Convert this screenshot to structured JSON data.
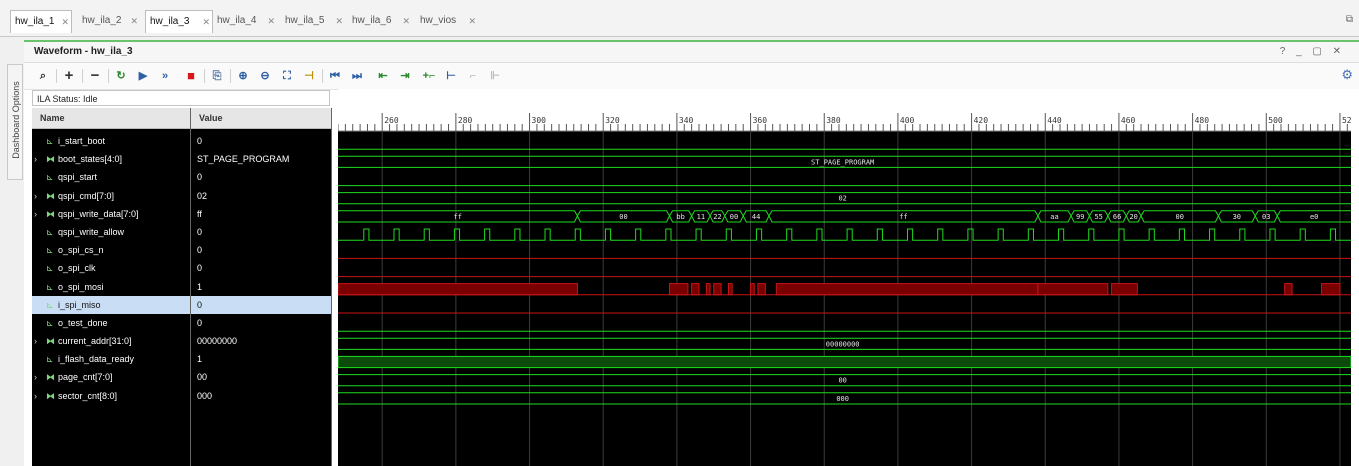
{
  "tabs": [
    {
      "label": "hw_ila_1",
      "active": true
    },
    {
      "label": "hw_ila_2",
      "active": false
    },
    {
      "label": "hw_ila_3",
      "active": true
    },
    {
      "label": "hw_ila_4",
      "active": false
    },
    {
      "label": "hw_ila_5",
      "active": false
    },
    {
      "label": "hw_ila_6",
      "active": false
    },
    {
      "label": "hw_vios",
      "active": false
    }
  ],
  "sidebar": {
    "dashboard_label": "Dashboard Options"
  },
  "panel": {
    "title": "Waveform - hw_ila_3",
    "controls": "? _ ▢ ✕"
  },
  "status": {
    "text": "ILA Status: Idle"
  },
  "columns": {
    "name": "Name",
    "value": "Value"
  },
  "signals": [
    {
      "name": "i_start_boot",
      "value": "0",
      "bus": false
    },
    {
      "name": "boot_states[4:0]",
      "value": "ST_PAGE_PROGRAM",
      "bus": true
    },
    {
      "name": "qspi_start",
      "value": "0",
      "bus": false
    },
    {
      "name": "qspi_cmd[7:0]",
      "value": "02",
      "bus": true
    },
    {
      "name": "qspi_write_data[7:0]",
      "value": "ff",
      "bus": true
    },
    {
      "name": "qspi_write_allow",
      "value": "0",
      "bus": false
    },
    {
      "name": "o_spi_cs_n",
      "value": "0",
      "bus": false
    },
    {
      "name": "o_spi_clk",
      "value": "0",
      "bus": false
    },
    {
      "name": "o_spi_mosi",
      "value": "1",
      "bus": false
    },
    {
      "name": "i_spi_miso",
      "value": "0",
      "bus": false,
      "selected": true
    },
    {
      "name": "o_test_done",
      "value": "0",
      "bus": false
    },
    {
      "name": "current_addr[31:0]",
      "value": "00000000",
      "bus": true
    },
    {
      "name": "i_flash_data_ready",
      "value": "1",
      "bus": false
    },
    {
      "name": "page_cnt[7:0]",
      "value": "00",
      "bus": true
    },
    {
      "name": "sector_cnt[8:0]",
      "value": "000",
      "bus": true
    }
  ],
  "timeline": {
    "ticks": [
      "260",
      "280",
      "300",
      "320",
      "340",
      "360",
      "380",
      "400",
      "420",
      "440",
      "460",
      "480",
      "500",
      "520"
    ],
    "start": 248,
    "end": 523
  },
  "wave_labels": {
    "boot_states": "ST_PAGE_PROGRAM",
    "qspi_cmd": "02",
    "current_addr": "00000000",
    "page_cnt": "00",
    "sector_cnt": "000",
    "qspi_write_data": [
      "ff",
      "00",
      "bb",
      "11",
      "22",
      "00",
      "44",
      "ff",
      "aa",
      "99",
      "55",
      "66",
      "20",
      "00",
      "30",
      "03",
      "e0"
    ]
  },
  "colors": {
    "wave_green": "#1fdc1f",
    "wave_red": "#c81414",
    "miso_red": "#7a0000",
    "grid": "#3c3c3c",
    "selected": "#c9def5"
  },
  "icons": {
    "search": "search-icon",
    "add": "plus-icon",
    "remove": "minus-icon",
    "run": "play-icon",
    "stop": "stop-icon",
    "zoom_in": "zoom-in-icon",
    "zoom_out": "zoom-out-icon",
    "settings": "gear-icon"
  }
}
